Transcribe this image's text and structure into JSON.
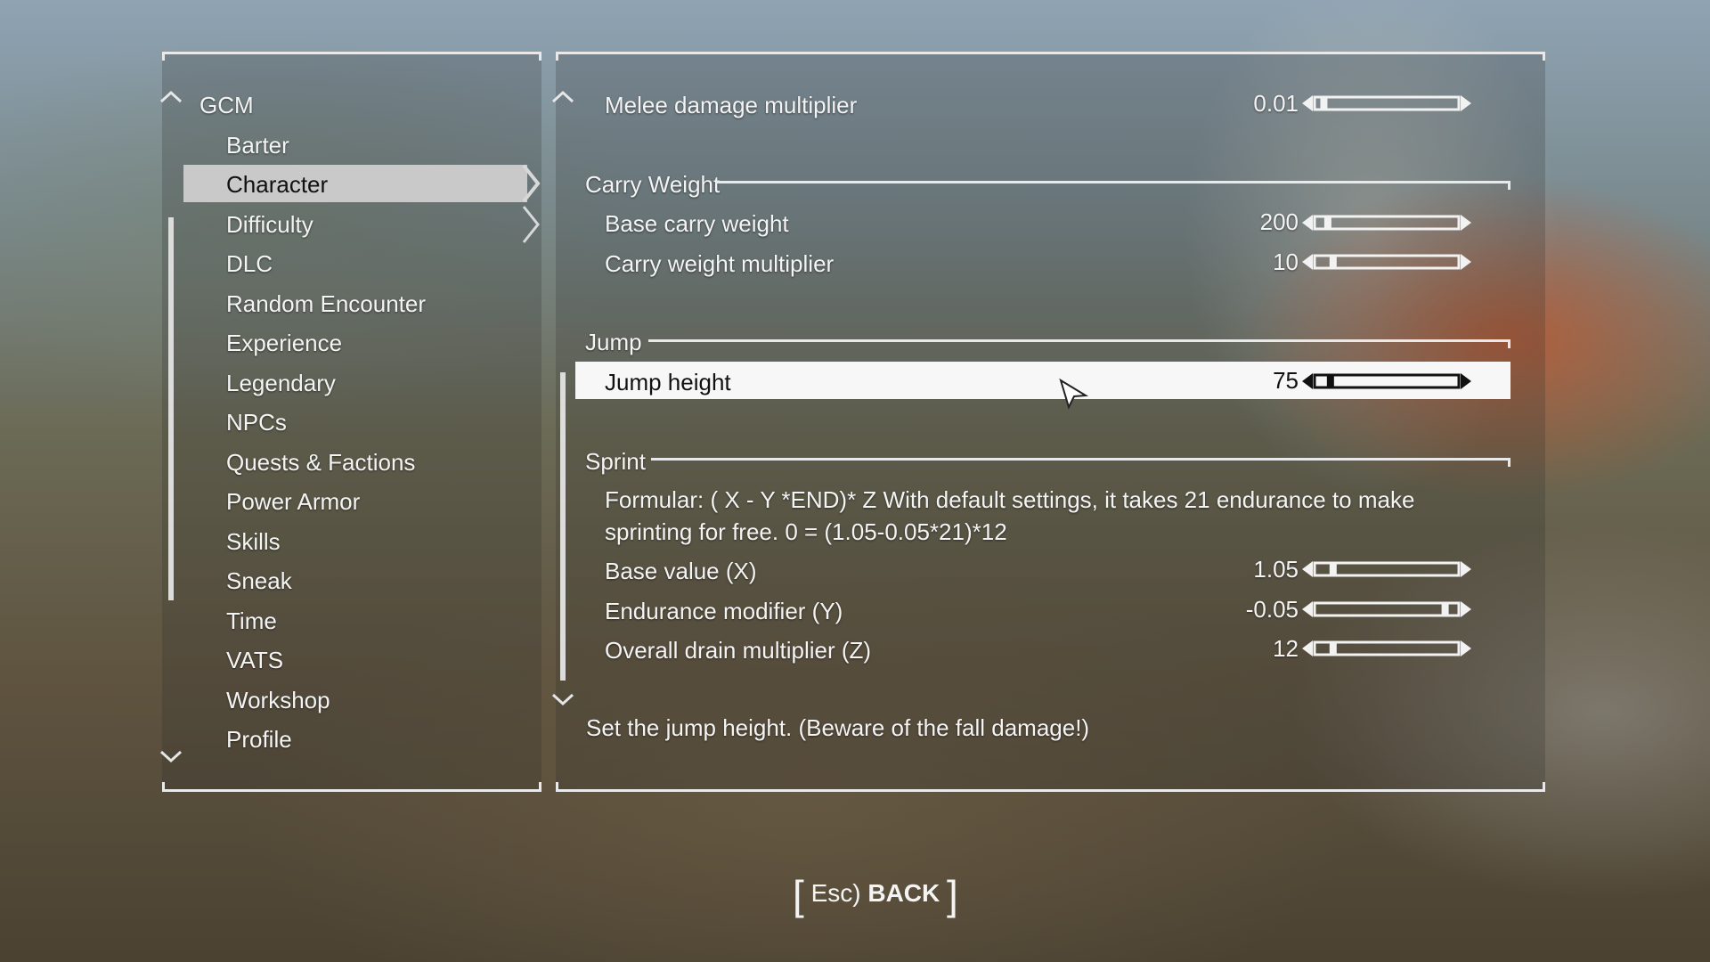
{
  "nav": {
    "root_label": "GCM",
    "items": [
      {
        "label": "Barter"
      },
      {
        "label": "Character",
        "selected": true
      },
      {
        "label": "Difficulty"
      },
      {
        "label": "DLC"
      },
      {
        "label": "Random Encounter"
      },
      {
        "label": "Experience"
      },
      {
        "label": "Legendary"
      },
      {
        "label": "NPCs"
      },
      {
        "label": "Quests & Factions"
      },
      {
        "label": "Power Armor"
      },
      {
        "label": "Skills"
      },
      {
        "label": "Sneak"
      },
      {
        "label": "Time"
      },
      {
        "label": "VATS"
      },
      {
        "label": "Workshop"
      },
      {
        "label": "Profile"
      }
    ]
  },
  "settings": {
    "melee": {
      "label": "Melee damage multiplier",
      "value": "0.01",
      "level": 0.03
    },
    "carry_weight": {
      "title": "Carry Weight",
      "base": {
        "label": "Base carry weight",
        "value": "200",
        "level": 0.06
      },
      "multiplier": {
        "label": "Carry weight multiplier",
        "value": "10",
        "level": 0.1
      }
    },
    "jump": {
      "title": "Jump",
      "height": {
        "label": "Jump height",
        "value": "75",
        "level": 0.08
      }
    },
    "sprint": {
      "title": "Sprint",
      "formula": "Formular: ( X - Y *END)* Z With default settings, it takes 21 endurance to make sprinting for free. 0 = (1.05-0.05*21)*12",
      "base_value": {
        "label": "Base value (X)",
        "value": "1.05",
        "level": 0.1
      },
      "endurance_modifier": {
        "label": "Endurance modifier (Y)",
        "value": "-0.05",
        "level": 0.95
      },
      "drain_multiplier": {
        "label": "Overall drain multiplier (Z)",
        "value": "12",
        "level": 0.1
      }
    }
  },
  "description": "Set the jump height. (Beware of the fall damage!)",
  "footer": {
    "key": "Esc)",
    "back_label": "BACK"
  },
  "colors": {
    "frame": "#e9e9e9",
    "selected_bg": "#c9c9c9",
    "highlight_bg": "#f7f7f7"
  },
  "icons": {
    "scroll_up": "chevron-up-icon",
    "scroll_down": "chevron-down-icon",
    "submenu": "chevron-right-icon",
    "cursor": "mouse-pointer-icon"
  }
}
